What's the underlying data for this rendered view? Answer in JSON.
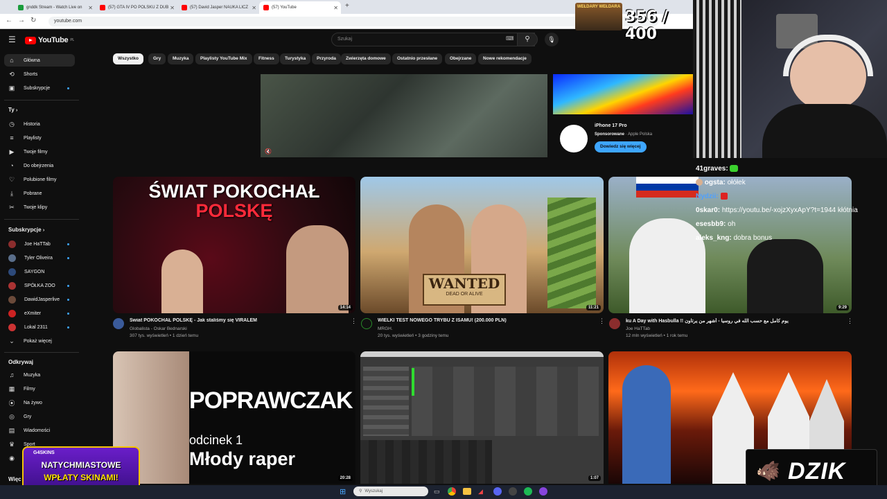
{
  "browser": {
    "tabs": [
      {
        "title": "gnddk Stream - Watch Live on",
        "color": "#1a9c3c"
      },
      {
        "title": "(57) GTA IV PO POLSKU Z DUB",
        "color": "#ff0000"
      },
      {
        "title": "(57) David Jasper NAUKA LICZ",
        "color": "#ff0000"
      },
      {
        "title": "(57) YouTube",
        "color": "#ff0000"
      }
    ],
    "new_tab": "+",
    "url": "youtube.com"
  },
  "youtube": {
    "logo_text": "YouTube",
    "logo_region": "PL",
    "search_placeholder": "Szukaj",
    "chips": [
      "Wszystko",
      "Gry",
      "Muzyka",
      "Playlisty YouTube Mix",
      "Fitness",
      "Turystyka",
      "Przyroda",
      "Zwierzęta domowe",
      "Ostatnio przesłane",
      "Obejrzane",
      "Nowe rekomendacje"
    ],
    "sidebar": {
      "main": [
        {
          "label": "Główna",
          "icon": "⌂"
        },
        {
          "label": "Shorts",
          "icon": "⟲"
        },
        {
          "label": "Subskrypcje",
          "icon": "▣"
        }
      ],
      "you_header": "Ty",
      "you": [
        {
          "label": "Historia",
          "icon": "◷"
        },
        {
          "label": "Playlisty",
          "icon": "≡"
        },
        {
          "label": "Twoje filmy",
          "icon": "▶"
        },
        {
          "label": "Do obejrzenia",
          "icon": "◔"
        },
        {
          "label": "Polubione filmy",
          "icon": "👍"
        },
        {
          "label": "Pobrane",
          "icon": "⤓"
        },
        {
          "label": "Twoje klipy",
          "icon": "✂"
        }
      ],
      "subs_header": "Subskrypcje",
      "subs": [
        {
          "label": "Joe HaTTab",
          "color": "#8b2d2d"
        },
        {
          "label": "Tyler Oliveira",
          "color": "#5a6e8a"
        },
        {
          "label": "SAYGON",
          "color": "#2d4a7a"
        },
        {
          "label": "SPÓŁKA ZOO",
          "color": "#a33"
        },
        {
          "label": "DawidJasperlive",
          "color": "#6b4a3a"
        },
        {
          "label": "eXmiter",
          "color": "#c22"
        },
        {
          "label": "Lokal 2311",
          "color": "#c33"
        },
        {
          "label": "Pokaż więcej",
          "color": ""
        }
      ],
      "explore_header": "Odkrywaj",
      "explore": [
        {
          "label": "Muzyka",
          "icon": "♫"
        },
        {
          "label": "Filmy",
          "icon": "🎬"
        },
        {
          "label": "Na żywo",
          "icon": "((·))"
        },
        {
          "label": "Gry",
          "icon": "🎮"
        },
        {
          "label": "Wiadomości",
          "icon": "▤"
        },
        {
          "label": "Sport",
          "icon": "🏆"
        },
        {
          "label": "",
          "icon": "◎"
        }
      ],
      "more_header": "Więc"
    },
    "ad": {
      "title": "iPhone 17 Pro",
      "sponsor_label": "Sponsorowane",
      "advertiser": "Apple Polska",
      "cta": "Dowiedz się więcej"
    },
    "videos": [
      {
        "title": "Świat POKOCHAŁ POLSKĘ - Jak staliśmy się VIRALEM",
        "channel": "Globalista - Oskar Bednarski",
        "meta": "307 tys. wyświetleń • 1 dzień temu",
        "duration": "14:14",
        "thumb_text": "ŚWIAT POKOCHAŁ",
        "thumb_text2": "POLSKĘ"
      },
      {
        "title": "WIELKI TEST NOWEGO TRYBU Z ISAMU! (200.000 PLN)",
        "channel": "MRGH.",
        "meta": "20 tys. wyświetleń • 3 godziny temu",
        "duration": "11:21",
        "thumb_text": "WANTED",
        "thumb_text2": "DEAD OR ALIVE"
      },
      {
        "title": "ku A Day with Hasbulla !! يوم كامل مع حسب الله في روسيا - أشهر من يرتاون",
        "channel": "Joe HaTTab",
        "meta": "12 mln wyświetleń • 1 rok temu",
        "duration": "9:29",
        "thumb_text": "",
        "thumb_text2": ""
      },
      {
        "title": "",
        "channel": "",
        "meta": "",
        "duration": "20:28",
        "thumb_text": "POPRAWCZAK",
        "thumb_text2": "odcinek 1",
        "thumb_text3": "Młody raper"
      },
      {
        "title": "",
        "channel": "",
        "meta": "",
        "duration": "1:07",
        "thumb_text": "",
        "thumb_text2": ""
      },
      {
        "title": "",
        "channel": "",
        "meta": "",
        "duration": "",
        "thumb_text": "",
        "thumb_text2": ""
      }
    ]
  },
  "stream": {
    "counter": "356 / 400",
    "counter_label": "WEŁDARY WEŁDARA",
    "chat": [
      {
        "user": "41graves:",
        "msg": "",
        "color": "#ffffff"
      },
      {
        "user": "ogsta:",
        "msg": "ołółek",
        "color": "#ffffff"
      },
      {
        "user": "Nydzii:",
        "msg": "",
        "color": "#4ea0ff"
      },
      {
        "user": "0skar0:",
        "msg": "https://youtu.be/-xojzXyxApY?t=1944 kłótnia",
        "color": "#ffffff"
      },
      {
        "user": "esesbb9:",
        "msg": "oh",
        "color": "#ffffff"
      },
      {
        "user": "aleks_kng:",
        "msg": "dobra bonus",
        "color": "#ffffff"
      }
    ],
    "promo_brand": "G4SKINS",
    "promo_line1": "NATYCHMIASTOWE",
    "promo_line2": "WPŁATY SKINAMI!",
    "sponsor_logo": "DZIK"
  },
  "taskbar": {
    "search_placeholder": "Wyszukaj"
  }
}
